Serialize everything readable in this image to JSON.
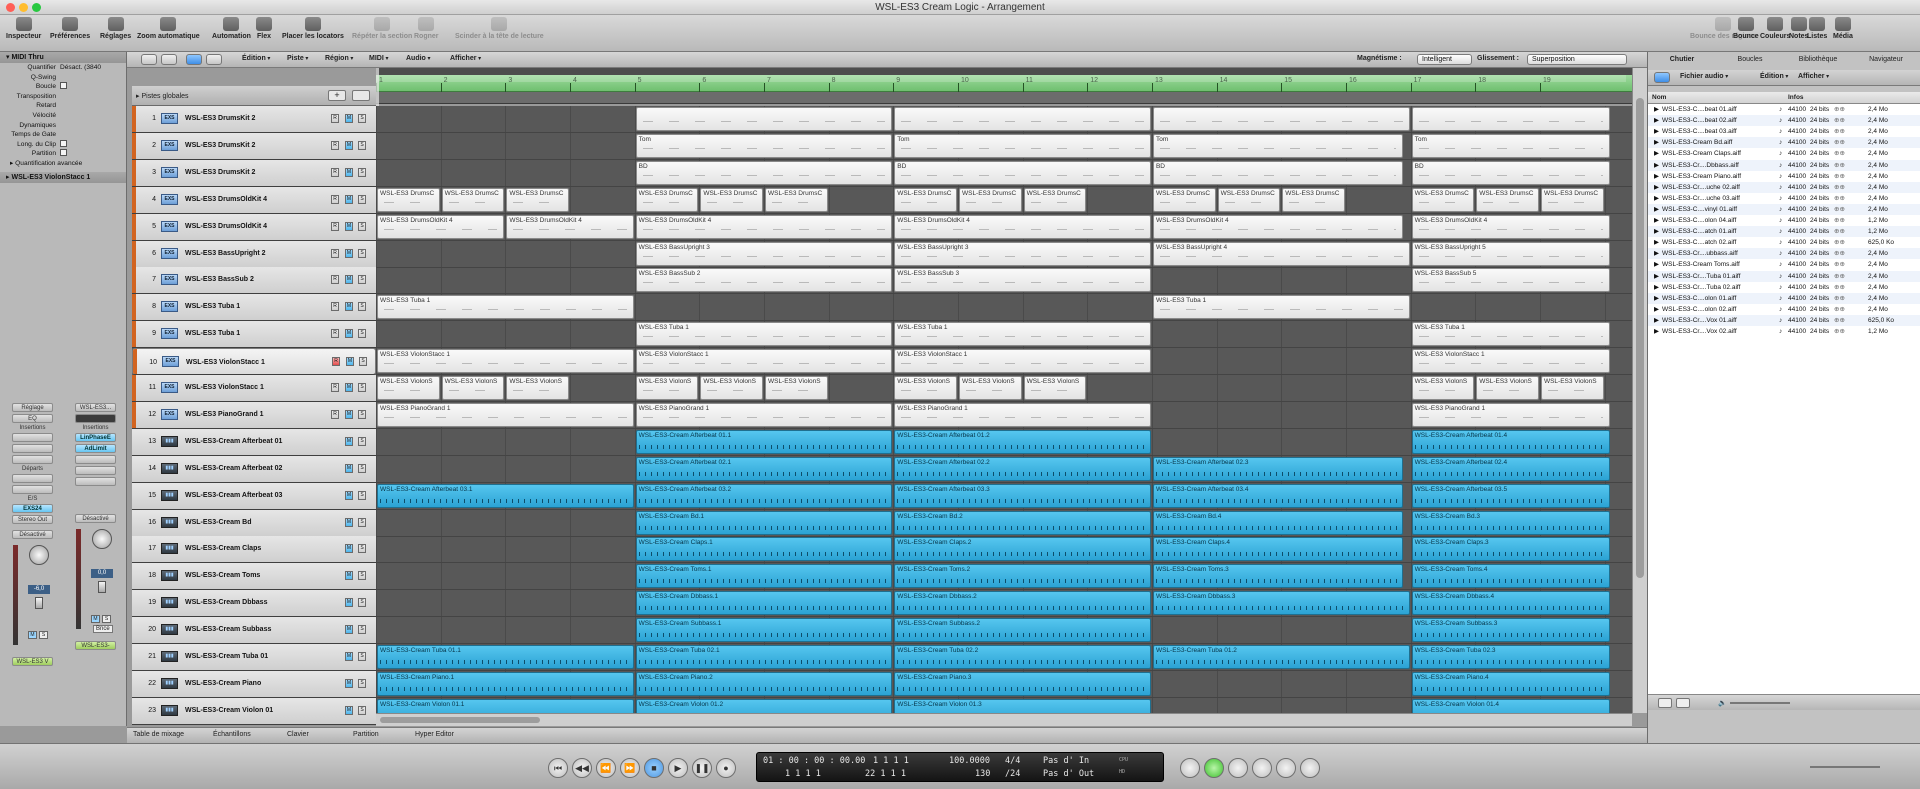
{
  "window": {
    "title": "WSL-ES3 Cream Logic - Arrangement"
  },
  "toolbar": {
    "left": [
      {
        "label": "Inspecteur",
        "enabled": true
      },
      {
        "label": "Préférences",
        "enabled": true
      },
      {
        "label": "Réglages",
        "enabled": true
      },
      {
        "label": "Zoom automatique",
        "enabled": true
      },
      {
        "label": "Automation",
        "enabled": true
      },
      {
        "label": "Flex",
        "enabled": true
      },
      {
        "label": "Placer les locators",
        "enabled": true
      },
      {
        "label": "Répéter la section",
        "enabled": false
      },
      {
        "label": "Rogner",
        "enabled": false
      },
      {
        "label": "Scinder à la tête de lecture",
        "enabled": false
      }
    ],
    "right": [
      {
        "label": "Bounce des régions",
        "enabled": false
      },
      {
        "label": "Bounce",
        "enabled": true
      },
      {
        "label": "Couleurs",
        "enabled": true
      },
      {
        "label": "Notes",
        "enabled": true
      },
      {
        "label": "Listes",
        "enabled": true
      },
      {
        "label": "Média",
        "enabled": true
      }
    ]
  },
  "inspector": {
    "header": "MIDI Thru",
    "rows": [
      {
        "label": "Quantifier",
        "value": "Désact. (3840"
      },
      {
        "label": "Q-Swing",
        "value": ""
      },
      {
        "label": "Boucle",
        "value": ""
      },
      {
        "label": "Transposition",
        "value": ""
      },
      {
        "label": "Retard",
        "value": ""
      },
      {
        "label": "Vélocité",
        "value": ""
      },
      {
        "label": "Dynamiques",
        "value": ""
      },
      {
        "label": "Temps de Gate",
        "value": ""
      },
      {
        "label": "Long. du Clip",
        "value": ""
      },
      {
        "label": "Partition",
        "value": ""
      }
    ],
    "advanced": "Quantification avancée",
    "track": "WSL-ES3 ViolonStacc 1",
    "strips": [
      {
        "setting": "Réglage",
        "eq": "EQ",
        "inserts": "Insertions",
        "plugins": [],
        "sends": "Départs",
        "io": "E/S",
        "input": "EXS24",
        "output": "Stereo Out",
        "auto": "Désactivé",
        "value": "-6,0",
        "name": "WSL-ES3 V"
      },
      {
        "setting": "WSL-ES3...",
        "eq": "",
        "inserts": "Insertions",
        "plugins": [
          "LinPhaseE",
          "AdLimit"
        ],
        "sends": "",
        "io": "",
        "input": "",
        "output": "",
        "auto": "Désactivé",
        "value": "0,0",
        "name": "WSL-ES3-",
        "bounce": "Bnce"
      }
    ]
  },
  "arrange": {
    "menus": [
      "Édition",
      "Piste",
      "Région",
      "MIDI",
      "Audio",
      "Afficher"
    ],
    "snap_label": "Magnétisme :",
    "snap_value": "Intelligent",
    "drag_label": "Glissement :",
    "drag_value": "Superposition",
    "global_tracks": "Pistes globales",
    "bars": [
      "1",
      "2",
      "3",
      "4",
      "5",
      "6",
      "7",
      "8",
      "9",
      "10",
      "11",
      "12",
      "13",
      "14",
      "15",
      "16",
      "17",
      "18",
      "19"
    ],
    "tracks": [
      {
        "n": "1",
        "type": "EXS",
        "name": "WSL-ES3 DrumsKit 2"
      },
      {
        "n": "2",
        "type": "EXS",
        "name": "WSL-ES3 DrumsKit 2"
      },
      {
        "n": "3",
        "type": "EXS",
        "name": "WSL-ES3 DrumsKit 2"
      },
      {
        "n": "4",
        "type": "EXS",
        "name": "WSL-ES3 DrumsOldKit 4"
      },
      {
        "n": "5",
        "type": "EXS",
        "name": "WSL-ES3 DrumsOldKit 4"
      },
      {
        "n": "6",
        "type": "EXS",
        "name": "WSL-ES3 BassUpright 2"
      },
      {
        "n": "7",
        "type": "EXS",
        "name": "WSL-ES3 BassSub 2"
      },
      {
        "n": "8",
        "type": "EXS",
        "name": "WSL-ES3 Tuba 1"
      },
      {
        "n": "9",
        "type": "EXS",
        "name": "WSL-ES3 Tuba 1"
      },
      {
        "n": "10",
        "type": "EXS",
        "name": "WSL-ES3 ViolonStacc 1",
        "selected": true
      },
      {
        "n": "11",
        "type": "EXS",
        "name": "WSL-ES3 ViolonStacc 1"
      },
      {
        "n": "12",
        "type": "EXS",
        "name": "WSL-ES3 PianoGrand 1"
      },
      {
        "n": "13",
        "type": "audio",
        "name": "WSL-ES3-Cream Afterbeat 01"
      },
      {
        "n": "14",
        "type": "audio",
        "name": "WSL-ES3-Cream Afterbeat 02"
      },
      {
        "n": "15",
        "type": "audio",
        "name": "WSL-ES3-Cream Afterbeat 03"
      },
      {
        "n": "16",
        "type": "audio",
        "name": "WSL-ES3-Cream Bd"
      },
      {
        "n": "17",
        "type": "audio",
        "name": "WSL-ES3-Cream Claps"
      },
      {
        "n": "18",
        "type": "audio",
        "name": "WSL-ES3-Cream Toms"
      },
      {
        "n": "19",
        "type": "audio",
        "name": "WSL-ES3-Cream Dbbass"
      },
      {
        "n": "20",
        "type": "audio",
        "name": "WSL-ES3-Cream Subbass"
      },
      {
        "n": "21",
        "type": "audio",
        "name": "WSL-ES3-Cream Tuba 01"
      },
      {
        "n": "22",
        "type": "audio",
        "name": "WSL-ES3-Cream Piano"
      },
      {
        "n": "23",
        "type": "audio",
        "name": "WSL-ES3-Cream Violon 01"
      }
    ],
    "regions": [
      [
        {
          "s": 5,
          "e": 9,
          "t": ""
        },
        {
          "s": 9,
          "e": 13,
          "t": ""
        },
        {
          "s": 13,
          "e": 17,
          "t": ""
        },
        {
          "s": 17,
          "e": 20.1,
          "t": ""
        }
      ],
      [
        {
          "s": 5,
          "e": 9,
          "t": "Tom"
        },
        {
          "s": 9,
          "e": 13,
          "t": "Tom"
        },
        {
          "s": 13,
          "e": 16.9,
          "t": "Tom"
        },
        {
          "s": 17,
          "e": 20.1,
          "t": "Tom"
        }
      ],
      [
        {
          "s": 5,
          "e": 9,
          "t": "BD"
        },
        {
          "s": 9,
          "e": 13,
          "t": "BD"
        },
        {
          "s": 13,
          "e": 16.9,
          "t": "BD"
        },
        {
          "s": 17,
          "e": 20.1,
          "t": "BD"
        }
      ],
      [
        {
          "s": 1,
          "e": 2,
          "t": "WSL-ES3 DrumsC"
        },
        {
          "s": 2,
          "e": 3,
          "t": "WSL-ES3 DrumsC"
        },
        {
          "s": 3,
          "e": 4,
          "t": "WSL-ES3 DrumsC"
        },
        {
          "s": 5,
          "e": 6,
          "t": "WSL-ES3 DrumsC"
        },
        {
          "s": 6,
          "e": 7,
          "t": "WSL-ES3 DrumsC"
        },
        {
          "s": 7,
          "e": 8,
          "t": "WSL-ES3 DrumsC"
        },
        {
          "s": 9,
          "e": 10,
          "t": "WSL-ES3 DrumsC"
        },
        {
          "s": 10,
          "e": 11,
          "t": "WSL-ES3 DrumsC"
        },
        {
          "s": 11,
          "e": 12,
          "t": "WSL-ES3 DrumsC"
        },
        {
          "s": 13,
          "e": 14,
          "t": "WSL-ES3 DrumsC"
        },
        {
          "s": 14,
          "e": 15,
          "t": "WSL-ES3 DrumsC"
        },
        {
          "s": 15,
          "e": 16,
          "t": "WSL-ES3 DrumsC"
        },
        {
          "s": 17,
          "e": 18,
          "t": "WSL-ES3 DrumsC"
        },
        {
          "s": 18,
          "e": 19,
          "t": "WSL-ES3 DrumsC"
        },
        {
          "s": 19,
          "e": 20,
          "t": "WSL-ES3 DrumsC"
        }
      ],
      [
        {
          "s": 1,
          "e": 3,
          "t": "WSL-ES3 DrumsOldKit 4"
        },
        {
          "s": 3,
          "e": 5,
          "t": "WSL-ES3 DrumsOldKit 4"
        },
        {
          "s": 5,
          "e": 9,
          "t": "WSL-ES3 DrumsOldKit 4"
        },
        {
          "s": 9,
          "e": 13,
          "t": "WSL-ES3 DrumsOldKit 4"
        },
        {
          "s": 13,
          "e": 16.9,
          "t": "WSL-ES3 DrumsOldKit 4"
        },
        {
          "s": 17,
          "e": 20.1,
          "t": "WSL-ES3 DrumsOldKit 4"
        }
      ],
      [
        {
          "s": 5,
          "e": 9,
          "t": "WSL-ES3 BassUpright 3"
        },
        {
          "s": 9,
          "e": 13,
          "t": "WSL-ES3 BassUpright 3"
        },
        {
          "s": 13,
          "e": 17,
          "t": "WSL-ES3 BassUpright 4"
        },
        {
          "s": 17,
          "e": 20.1,
          "t": "WSL-ES3 BassUpright 5"
        }
      ],
      [
        {
          "s": 5,
          "e": 9,
          "t": "WSL-ES3 BassSub 2"
        },
        {
          "s": 9,
          "e": 13,
          "t": "WSL-ES3 BassSub 3"
        },
        {
          "s": 17,
          "e": 20.1,
          "t": "WSL-ES3 BassSub 5"
        }
      ],
      [
        {
          "s": 1,
          "e": 5,
          "t": "WSL-ES3 Tuba 1"
        },
        {
          "s": 13,
          "e": 17,
          "t": "WSL-ES3 Tuba 1"
        }
      ],
      [
        {
          "s": 5,
          "e": 9,
          "t": "WSL-ES3 Tuba 1"
        },
        {
          "s": 9,
          "e": 13,
          "t": "WSL-ES3 Tuba 1"
        },
        {
          "s": 17,
          "e": 20.1,
          "t": "WSL-ES3 Tuba 1"
        }
      ],
      [
        {
          "s": 1,
          "e": 5,
          "t": "WSL-ES3 ViolonStacc 1"
        },
        {
          "s": 5,
          "e": 9,
          "t": "WSL-ES3 ViolonStacc 1"
        },
        {
          "s": 9,
          "e": 13,
          "t": "WSL-ES3 ViolonStacc 1"
        },
        {
          "s": 17,
          "e": 20.1,
          "t": "WSL-ES3 ViolonStacc 1"
        }
      ],
      [
        {
          "s": 1,
          "e": 2,
          "t": "WSL-ES3 ViolonS"
        },
        {
          "s": 2,
          "e": 3,
          "t": "WSL-ES3 ViolonS"
        },
        {
          "s": 3,
          "e": 4,
          "t": "WSL-ES3 ViolonS"
        },
        {
          "s": 5,
          "e": 6,
          "t": "WSL-ES3 ViolonS"
        },
        {
          "s": 6,
          "e": 7,
          "t": "WSL-ES3 ViolonS"
        },
        {
          "s": 7,
          "e": 8,
          "t": "WSL-ES3 ViolonS"
        },
        {
          "s": 9,
          "e": 10,
          "t": "WSL-ES3 ViolonS"
        },
        {
          "s": 10,
          "e": 11,
          "t": "WSL-ES3 ViolonS"
        },
        {
          "s": 11,
          "e": 12,
          "t": "WSL-ES3 ViolonS"
        },
        {
          "s": 17,
          "e": 18,
          "t": "WSL-ES3 ViolonS"
        },
        {
          "s": 18,
          "e": 19,
          "t": "WSL-ES3 ViolonS"
        },
        {
          "s": 19,
          "e": 20,
          "t": "WSL-ES3 ViolonS"
        }
      ],
      [
        {
          "s": 1,
          "e": 5,
          "t": "WSL-ES3 PianoGrand 1"
        },
        {
          "s": 5,
          "e": 9,
          "t": "WSL-ES3 PianoGrand 1"
        },
        {
          "s": 9,
          "e": 13,
          "t": "WSL-ES3 PianoGrand 1"
        },
        {
          "s": 17,
          "e": 20.1,
          "t": "WSL-ES3 PianoGrand 1"
        }
      ],
      [
        {
          "s": 5,
          "e": 9,
          "t": "WSL-ES3-Cream Afterbeat 01.1"
        },
        {
          "s": 9,
          "e": 13,
          "t": "WSL-ES3-Cream Afterbeat 01.2"
        },
        {
          "s": 17,
          "e": 20.1,
          "t": "WSL-ES3-Cream Afterbeat 01.4"
        }
      ],
      [
        {
          "s": 5,
          "e": 9,
          "t": "WSL-ES3-Cream Afterbeat 02.1"
        },
        {
          "s": 9,
          "e": 13,
          "t": "WSL-ES3-Cream Afterbeat 02.2"
        },
        {
          "s": 13,
          "e": 16.9,
          "t": "WSL-ES3-Cream Afterbeat 02.3"
        },
        {
          "s": 17,
          "e": 20.1,
          "t": "WSL-ES3-Cream Afterbeat 02.4"
        }
      ],
      [
        {
          "s": 1,
          "e": 5,
          "t": "WSL-ES3-Cream Afterbeat 03.1"
        },
        {
          "s": 5,
          "e": 9,
          "t": "WSL-ES3-Cream Afterbeat 03.2"
        },
        {
          "s": 9,
          "e": 13,
          "t": "WSL-ES3-Cream Afterbeat 03.3"
        },
        {
          "s": 13,
          "e": 16.9,
          "t": "WSL-ES3-Cream Afterbeat 03.4"
        },
        {
          "s": 17,
          "e": 20.1,
          "t": "WSL-ES3-Cream Afterbeat 03.5"
        }
      ],
      [
        {
          "s": 5,
          "e": 9,
          "t": "WSL-ES3-Cream Bd.1"
        },
        {
          "s": 9,
          "e": 13,
          "t": "WSL-ES3-Cream Bd.2"
        },
        {
          "s": 13,
          "e": 16.9,
          "t": "WSL-ES3-Cream Bd.4"
        },
        {
          "s": 17,
          "e": 20.1,
          "t": "WSL-ES3-Cream Bd.3"
        }
      ],
      [
        {
          "s": 5,
          "e": 9,
          "t": "WSL-ES3-Cream Claps.1"
        },
        {
          "s": 9,
          "e": 13,
          "t": "WSL-ES3-Cream Claps.2"
        },
        {
          "s": 13,
          "e": 16.9,
          "t": "WSL-ES3-Cream Claps.4"
        },
        {
          "s": 17,
          "e": 20.1,
          "t": "WSL-ES3-Cream Claps.3"
        }
      ],
      [
        {
          "s": 5,
          "e": 9,
          "t": "WSL-ES3-Cream Toms.1"
        },
        {
          "s": 9,
          "e": 13,
          "t": "WSL-ES3-Cream Toms.2"
        },
        {
          "s": 13,
          "e": 16.9,
          "t": "WSL-ES3-Cream Toms.3"
        },
        {
          "s": 17,
          "e": 20.1,
          "t": "WSL-ES3-Cream Toms.4"
        }
      ],
      [
        {
          "s": 5,
          "e": 9,
          "t": "WSL-ES3-Cream Dbbass.1"
        },
        {
          "s": 9,
          "e": 13,
          "t": "WSL-ES3-Cream Dbbass.2"
        },
        {
          "s": 13,
          "e": 17,
          "t": "WSL-ES3-Cream Dbbass.3"
        },
        {
          "s": 17,
          "e": 20.1,
          "t": "WSL-ES3-Cream Dbbass.4"
        }
      ],
      [
        {
          "s": 5,
          "e": 9,
          "t": "WSL-ES3-Cream Subbass.1"
        },
        {
          "s": 9,
          "e": 13,
          "t": "WSL-ES3-Cream Subbass.2"
        },
        {
          "s": 17,
          "e": 20.1,
          "t": "WSL-ES3-Cream Subbass.3"
        }
      ],
      [
        {
          "s": 1,
          "e": 5,
          "t": "WSL-ES3-Cream Tuba 01.1"
        },
        {
          "s": 5,
          "e": 9,
          "t": "WSL-ES3-Cream Tuba 02.1"
        },
        {
          "s": 9,
          "e": 13,
          "t": "WSL-ES3-Cream Tuba 02.2"
        },
        {
          "s": 13,
          "e": 17,
          "t": "WSL-ES3-Cream Tuba 01.2"
        },
        {
          "s": 17,
          "e": 20.1,
          "t": "WSL-ES3-Cream Tuba 02.3"
        }
      ],
      [
        {
          "s": 1,
          "e": 5,
          "t": "WSL-ES3-Cream Piano.1"
        },
        {
          "s": 5,
          "e": 9,
          "t": "WSL-ES3-Cream Piano.2"
        },
        {
          "s": 9,
          "e": 13,
          "t": "WSL-ES3-Cream Piano.3"
        },
        {
          "s": 17,
          "e": 20.1,
          "t": "WSL-ES3-Cream Piano.4"
        }
      ],
      [
        {
          "s": 1,
          "e": 5,
          "t": "WSL-ES3-Cream Violon 01.1"
        },
        {
          "s": 5,
          "e": 9,
          "t": "WSL-ES3-Cream Violon 01.2"
        },
        {
          "s": 9,
          "e": 13,
          "t": "WSL-ES3-Cream Violon 01.3"
        },
        {
          "s": 17,
          "e": 20.1,
          "t": "WSL-ES3-Cream Violon 01.4"
        }
      ]
    ]
  },
  "bottom_tabs": [
    "Table de mixage",
    "Échantillons",
    "Clavier",
    "Partition",
    "Hyper Editor"
  ],
  "media": {
    "tabs": [
      "Chutier",
      "Boucles",
      "Bibliothèque",
      "Navigateur"
    ],
    "menus": [
      "Fichier audio",
      "Édition",
      "Afficher"
    ],
    "columns": [
      "Nom",
      "Infos"
    ],
    "files": [
      {
        "name": "WSL-ES3-C....beat 01.aiff",
        "rate": "44100",
        "bits": "24 bits",
        "size": "2,4 Mo"
      },
      {
        "name": "WSL-ES3-C....beat 02.aiff",
        "rate": "44100",
        "bits": "24 bits",
        "size": "2,4 Mo"
      },
      {
        "name": "WSL-ES3-C....beat 03.aiff",
        "rate": "44100",
        "bits": "24 bits",
        "size": "2,4 Mo"
      },
      {
        "name": "WSL-ES3-Cream Bd.aiff",
        "rate": "44100",
        "bits": "24 bits",
        "size": "2,4 Mo"
      },
      {
        "name": "WSL-ES3-Cream Claps.aiff",
        "rate": "44100",
        "bits": "24 bits",
        "size": "2,4 Mo"
      },
      {
        "name": "WSL-ES3-Cr....Dbbass.aiff",
        "rate": "44100",
        "bits": "24 bits",
        "size": "2,4 Mo"
      },
      {
        "name": "WSL-ES3-Cream Piano.aiff",
        "rate": "44100",
        "bits": "24 bits",
        "size": "2,4 Mo"
      },
      {
        "name": "WSL-ES3-Cr....uche 02.aiff",
        "rate": "44100",
        "bits": "24 bits",
        "size": "2,4 Mo"
      },
      {
        "name": "WSL-ES3-Cr....uche 03.aiff",
        "rate": "44100",
        "bits": "24 bits",
        "size": "2,4 Mo"
      },
      {
        "name": "WSL-ES3-C....vinyl 01.aiff",
        "rate": "44100",
        "bits": "24 bits",
        "size": "2,4 Mo"
      },
      {
        "name": "WSL-ES3-C....olon 04.aiff",
        "rate": "44100",
        "bits": "24 bits",
        "size": "1,2 Mo"
      },
      {
        "name": "WSL-ES3-C....atch 01.aiff",
        "rate": "44100",
        "bits": "24 bits",
        "size": "1,2 Mo"
      },
      {
        "name": "WSL-ES3-C....atch 02.aiff",
        "rate": "44100",
        "bits": "24 bits",
        "size": "625,0 Ko"
      },
      {
        "name": "WSL-ES3-Cr....ubbass.aiff",
        "rate": "44100",
        "bits": "24 bits",
        "size": "2,4 Mo"
      },
      {
        "name": "WSL-ES3-Cream Toms.aiff",
        "rate": "44100",
        "bits": "24 bits",
        "size": "2,4 Mo"
      },
      {
        "name": "WSL-ES3-Cr....Tuba 01.aiff",
        "rate": "44100",
        "bits": "24 bits",
        "size": "2,4 Mo"
      },
      {
        "name": "WSL-ES3-Cr....Tuba 02.aiff",
        "rate": "44100",
        "bits": "24 bits",
        "size": "2,4 Mo"
      },
      {
        "name": "WSL-ES3-C....olon 01.aiff",
        "rate": "44100",
        "bits": "24 bits",
        "size": "2,4 Mo"
      },
      {
        "name": "WSL-ES3-C....olon 02.aiff",
        "rate": "44100",
        "bits": "24 bits",
        "size": "2,4 Mo"
      },
      {
        "name": "WSL-ES3-Cr....Vox 01.aiff",
        "rate": "44100",
        "bits": "24 bits",
        "size": "625,0 Ko"
      },
      {
        "name": "WSL-ES3-Cr....Vox 02.aiff",
        "rate": "44100",
        "bits": "24 bits",
        "size": "1,2 Mo"
      }
    ]
  },
  "transport": {
    "smpte": "01 : 00 : 00 : 00.00",
    "smpte2": "1   1   1   1",
    "bars": "1   1   1   1",
    "bars2": "22   1   1   1",
    "tempo": "100.0000",
    "tempo2": "130",
    "signature": "4/4",
    "division": "/24",
    "in": "Pas d' In",
    "out": "Pas d' Out",
    "cpu": "CPU",
    "hd": "HD"
  }
}
